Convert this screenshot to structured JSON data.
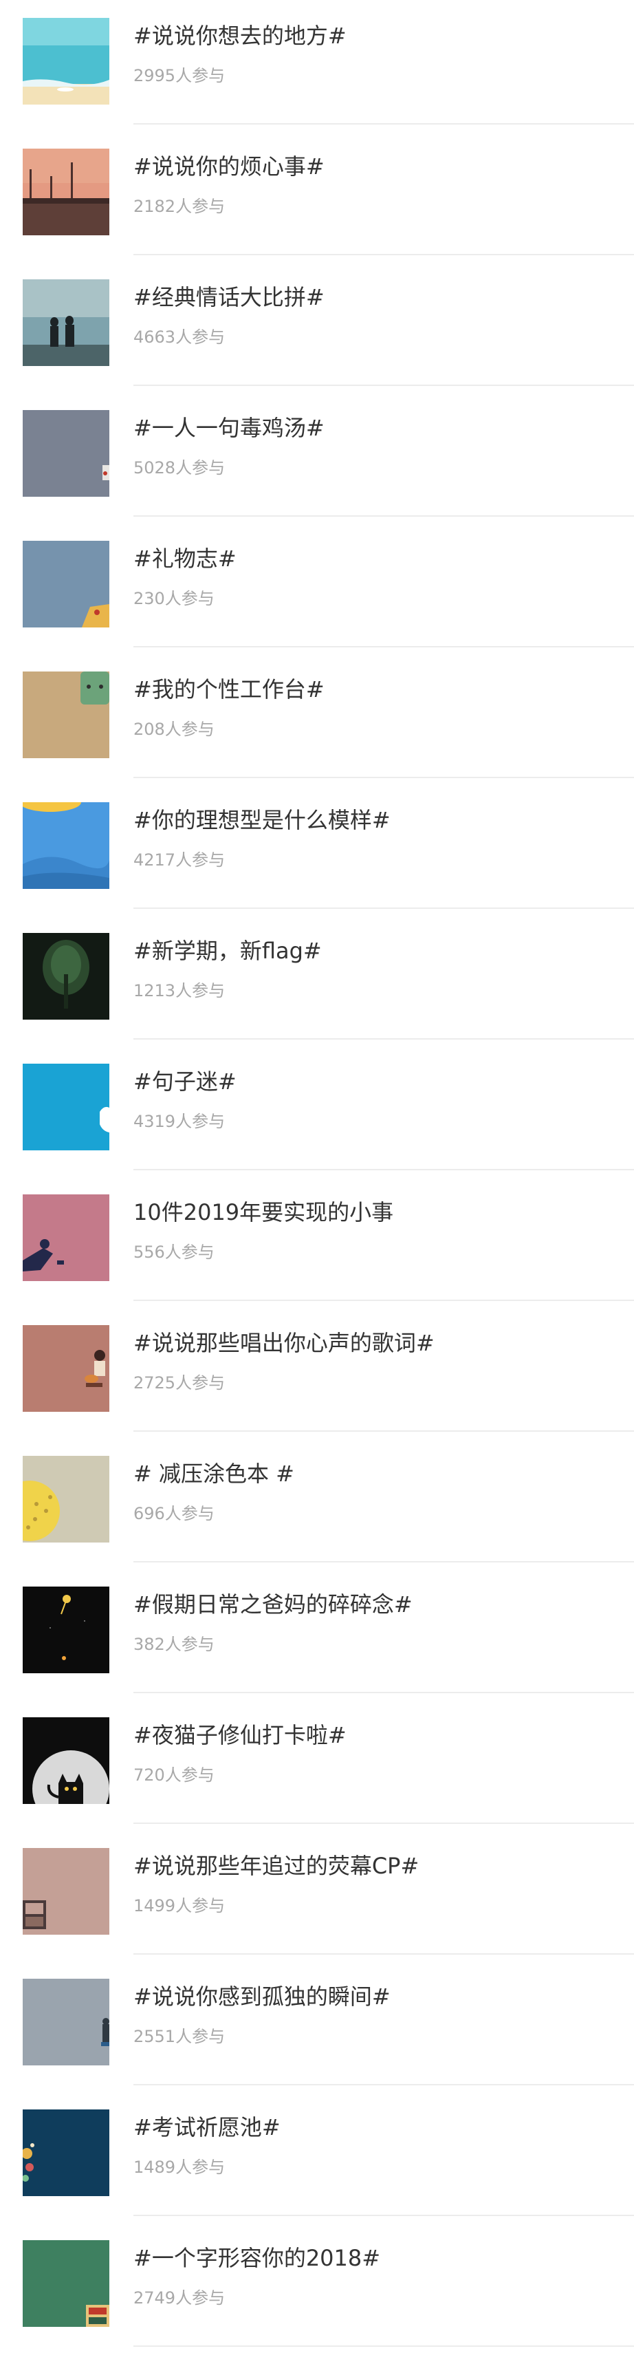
{
  "topics": [
    {
      "title": "#说说你想去的地方#",
      "count": "2995人参与",
      "icon": "beach-image-icon",
      "color": "#5fc2cc"
    },
    {
      "title": "#说说你的烦心事#",
      "count": "2182人参与",
      "icon": "sunset-pier-image-icon",
      "color": "#d98d7a"
    },
    {
      "title": "#经典情话大比拼#",
      "count": "4663人参与",
      "icon": "couple-seaside-image-icon",
      "color": "#7ea3ad"
    },
    {
      "title": "#一人一句毒鸡汤#",
      "count": "5028人参与",
      "icon": "gray-card-image-icon",
      "color": "#7a8292"
    },
    {
      "title": "#礼物志#",
      "count": "230人参与",
      "icon": "gift-image-icon",
      "color": "#7693ad"
    },
    {
      "title": "#我的个性工作台#",
      "count": "208人参与",
      "icon": "desk-image-icon",
      "color": "#c8a97d"
    },
    {
      "title": "#你的理想型是什么模样#",
      "count": "4217人参与",
      "icon": "sky-sun-image-icon",
      "color": "#4a9ae0"
    },
    {
      "title": "#新学期，新flag#",
      "count": "1213人参与",
      "icon": "forest-image-icon",
      "color": "#1f2a22"
    },
    {
      "title": "#句子迷#",
      "count": "4319人参与",
      "icon": "blue-sky-image-icon",
      "color": "#1aa3d4"
    },
    {
      "title": "10件2019年要实现的小事",
      "count": "556人参与",
      "icon": "pink-figure-image-icon",
      "color": "#c47a8a"
    },
    {
      "title": "#说说那些唱出你心声的歌词#",
      "count": "2725人参与",
      "icon": "guitar-girl-image-icon",
      "color": "#b97d70"
    },
    {
      "title": "# 减压涂色本 #",
      "count": "696人参与",
      "icon": "coloring-book-image-icon",
      "color": "#cfcab4"
    },
    {
      "title": "#假期日常之爸妈的碎碎念#",
      "count": "382人参与",
      "icon": "night-fireworks-image-icon",
      "color": "#0c0c0c"
    },
    {
      "title": "#夜猫子修仙打卡啦#",
      "count": "720人参与",
      "icon": "black-cat-moon-image-icon",
      "color": "#111111"
    },
    {
      "title": "#说说那些年追过的荧幕CP#",
      "count": "1499人参与",
      "icon": "pink-room-image-icon",
      "color": "#c4a096"
    },
    {
      "title": "#说说你感到孤独的瞬间#",
      "count": "2551人参与",
      "icon": "gray-lonely-image-icon",
      "color": "#9aa4ae"
    },
    {
      "title": "#考试祈愿池#",
      "count": "1489人参与",
      "icon": "navy-wish-image-icon",
      "color": "#0f3d5c"
    },
    {
      "title": "#一个字形容你的2018#",
      "count": "2749人参与",
      "icon": "green-2018-image-icon",
      "color": "#3e8060"
    }
  ]
}
